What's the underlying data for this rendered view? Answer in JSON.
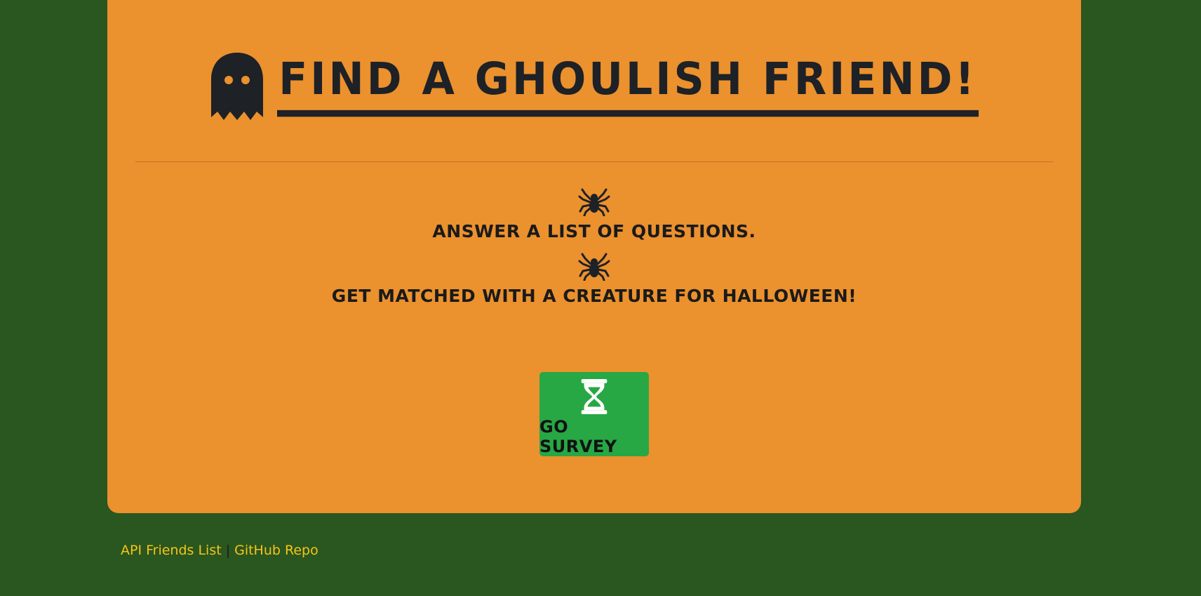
{
  "header": {
    "title": "Find a Ghoulish Friend!",
    "icon": "ghost-icon"
  },
  "steps": [
    {
      "icon": "spider-icon",
      "text": "Answer a list of questions."
    },
    {
      "icon": "spider-icon",
      "text": "Get matched with a creature for Halloween!"
    }
  ],
  "survey_button": {
    "icon": "hourglass-icon",
    "label": "Go Survey"
  },
  "footer": {
    "link1": "API Friends List",
    "separator": "|",
    "link2": "GitHub Repo"
  },
  "colors": {
    "background": "#2a5620",
    "panel": "#eb912e",
    "button": "#28a745",
    "text_dark": "#1e2126",
    "link": "#f5c518"
  }
}
